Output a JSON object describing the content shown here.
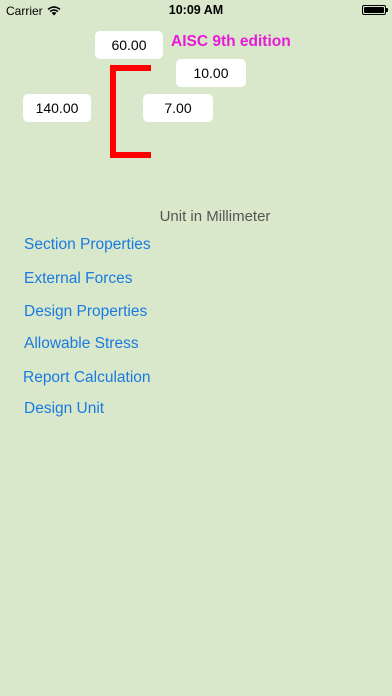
{
  "status_bar": {
    "carrier": "Carrier",
    "time": "10:09 AM"
  },
  "dimensions": {
    "flange_width": "60.00",
    "flange_thickness": "10.00",
    "depth": "140.00",
    "web_thickness": "7.00"
  },
  "edition_label": "AISC 9th edition",
  "unit_label": "Unit in Millimeter",
  "menu": {
    "section_properties": "Section Properties",
    "external_forces": "External Forces",
    "design_properties": "Design Properties",
    "allowable_stress": "Allowable Stress",
    "report_calculation": "Report Calculation",
    "design_unit": "Design Unit"
  },
  "icons": {
    "wifi": "wifi-icon",
    "battery": "battery-icon",
    "channel_section": "channel-section-icon"
  },
  "colors": {
    "background": "#d9e8cb",
    "link": "#1a7ae0",
    "edition": "#e81ad8",
    "channel": "#ff0000"
  }
}
